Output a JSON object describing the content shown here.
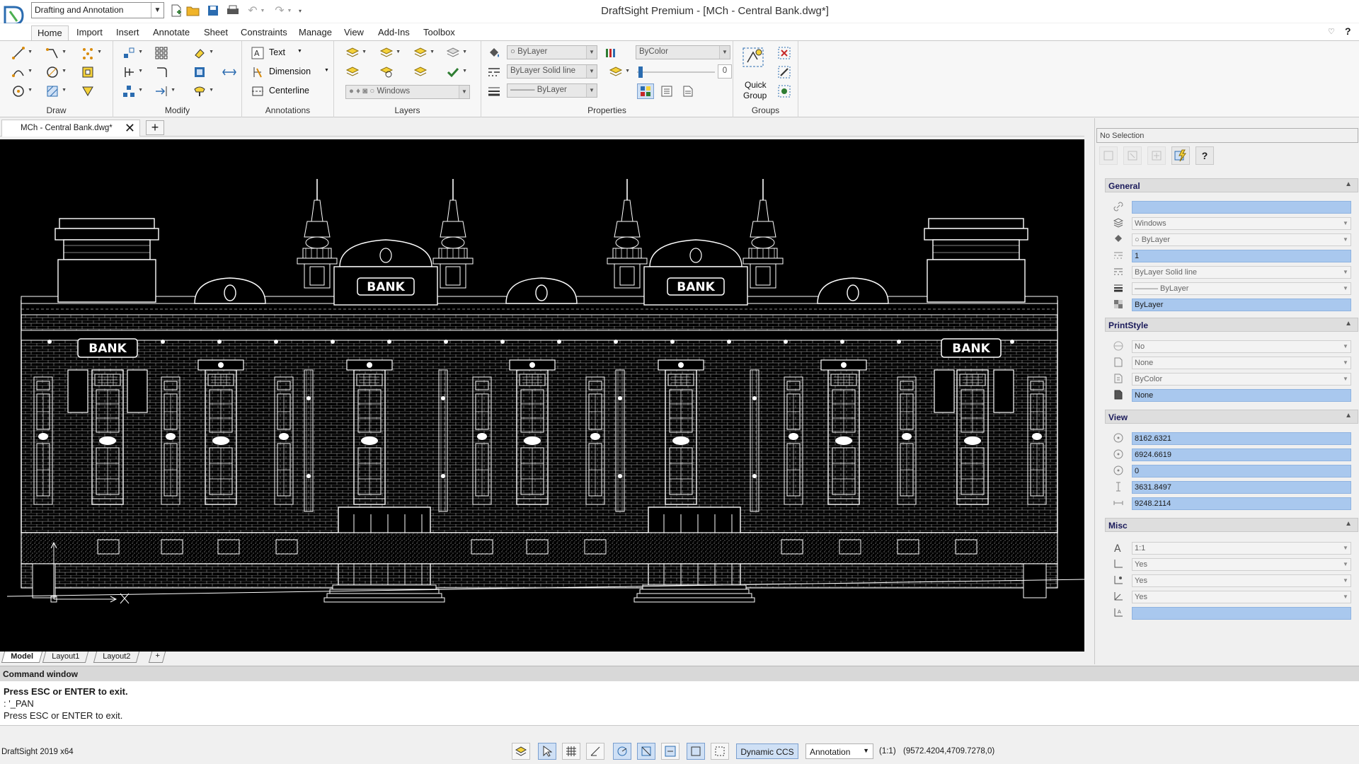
{
  "window": {
    "title": "DraftSight Premium - [MCh - Central Bank.dwg*]",
    "workspace": "Drafting and Annotation"
  },
  "ribbon_tabs": [
    {
      "label": "Home",
      "active": true
    },
    {
      "label": "Import"
    },
    {
      "label": "Insert"
    },
    {
      "label": "Annotate"
    },
    {
      "label": "Sheet"
    },
    {
      "label": "Constraints"
    },
    {
      "label": "Manage"
    },
    {
      "label": "View"
    },
    {
      "label": "Add-Ins"
    },
    {
      "label": "Toolbox"
    }
  ],
  "ribbon": {
    "panels": {
      "draw": "Draw",
      "modify": "Modify",
      "annotations": "Annotations",
      "layers": "Layers",
      "properties": "Properties",
      "groups": "Groups"
    },
    "annotations": {
      "text": "Text",
      "dimension": "Dimension",
      "centerline": "Centerline"
    },
    "layers": {
      "current_layer": "Windows"
    },
    "properties": {
      "color": "ByLayer",
      "linestyle": "ByLayer    Solid line",
      "lineweight": "——— ByLayer",
      "print_color": "ByColor",
      "transparency": "0"
    },
    "groups": {
      "quick_group_line1": "Quick",
      "quick_group_line2": "Group"
    }
  },
  "document_tab": {
    "label": "MCh - Central Bank.dwg*",
    "close": "✕",
    "add": "+"
  },
  "drawing": {
    "signs": [
      "BANK",
      "BANK",
      "BANK",
      "BANK"
    ]
  },
  "layout_tabs": [
    "Model",
    "Layout1",
    "Layout2",
    "+"
  ],
  "properties_panel": {
    "selection": "No Selection",
    "sections": {
      "general": "General",
      "printstyle": "PrintStyle",
      "view": "View",
      "misc": "Misc"
    },
    "general": {
      "hyperlink": "",
      "layer": "Windows",
      "color": "ByLayer",
      "linescale": "1",
      "linestyle": "ByLayer    Solid line",
      "lineweight": "——— ByLayer",
      "transparency": "ByLayer"
    },
    "printstyle": {
      "p1": "No",
      "p2": "None",
      "p3": "ByColor",
      "p4": "None"
    },
    "view": {
      "center_x": "8162.6321",
      "center_y": "6924.6619",
      "center_z": "0",
      "height": "3631.8497",
      "width": "9248.2114"
    },
    "misc": {
      "annotation_scale": "1:1",
      "ucs_icon_on": "Yes",
      "ucs_icon_origin": "Yes",
      "ucs_per_viewport": "Yes",
      "ucs_name": ""
    }
  },
  "command_window": {
    "title": "Command window",
    "lines": [
      "Press ESC or ENTER to exit.",
      ": '_PAN",
      "Press ESC or ENTER to exit."
    ]
  },
  "status_bar": {
    "version": "DraftSight 2019 x64",
    "dynamic_ccs": "Dynamic CCS",
    "annotation": "Annotation",
    "scale": "(1:1)",
    "coordinates": "(9572.4204,4709.7278,0)"
  },
  "colors": {
    "canvas": "#000000",
    "highlight_field": "#a9c8ee",
    "active_toggle": "#cfe0f5"
  }
}
